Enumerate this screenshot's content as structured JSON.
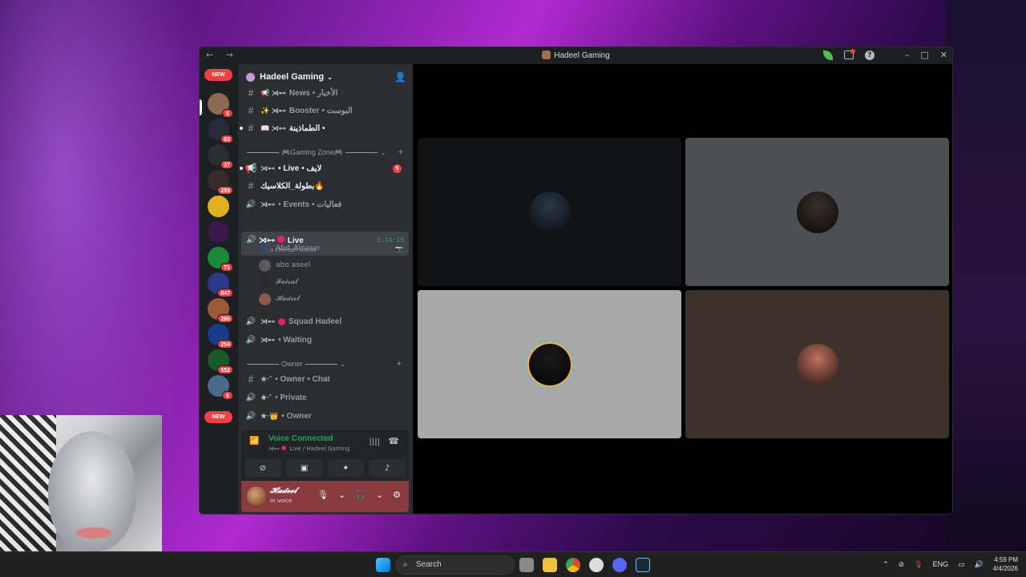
{
  "window": {
    "title": "Hadeel Gaming",
    "nav_arrows": "← →",
    "minimize": "–",
    "maximize": "□",
    "close": "✕"
  },
  "server": {
    "name": "Hadeel Gaming"
  },
  "guilds": [
    {
      "name": "server-1",
      "badge": "5",
      "color": "#8a6a50"
    },
    {
      "name": "server-2",
      "badge": "63",
      "color": "#2a2a3a"
    },
    {
      "name": "server-3",
      "badge": "37",
      "color": "#2a2d31"
    },
    {
      "name": "server-4",
      "badge": "255",
      "color": "#3a2a2a"
    },
    {
      "name": "server-5",
      "badge": "",
      "color": "#e0b020"
    },
    {
      "name": "server-6",
      "badge": "",
      "color": "#3a1a4a"
    },
    {
      "name": "server-7",
      "badge": "71",
      "color": "#1a8a3a"
    },
    {
      "name": "server-8",
      "badge": "847",
      "color": "#2a3a8a"
    },
    {
      "name": "server-9",
      "badge": "260",
      "color": "#9a5a3a"
    },
    {
      "name": "server-10",
      "badge": "254",
      "color": "#1a3a8a"
    },
    {
      "name": "server-11",
      "badge": "552",
      "color": "#1a5a2a"
    },
    {
      "name": "server-12",
      "badge": "6",
      "color": "#4a6a8a"
    }
  ],
  "guild_new_top": "NEW",
  "guild_new_bottom": "NEW",
  "channels": {
    "news": "News • الأخبار",
    "booster": "Booster • البوست",
    "mod": "الطماذينة •",
    "cat_gaming": "Gaming Zone",
    "live_text": "• Live • لايف",
    "live_text_badge": "5",
    "tournament": "بطولة_الكلاسيك",
    "events": "• Events • فعاليات",
    "live_voice": "Live",
    "live_status": "Set a channel status",
    "live_timer": "5:14:15",
    "squad": "Squad Hadeel",
    "waiting": "• Waiting",
    "cat_owner": "Owner",
    "owner_chat": "• Owner • Chat",
    "private": "• Private",
    "owner": "• Owner"
  },
  "voice_users": [
    {
      "name": "Abd_Alnaser",
      "color": "#3a4a5a"
    },
    {
      "name": "abo aseel",
      "color": "#5a5a5a"
    },
    {
      "name": "𝓕𝓪𝓲𝓼𝓪𝓵",
      "color": "#2a2a2a"
    },
    {
      "name": "𝓗𝓪𝓭𝓮𝓮𝓵",
      "color": "#8a5a4a"
    }
  ],
  "voice_panel": {
    "title": "Voice Connected",
    "subtitle": "Live / Hadeel Gaming"
  },
  "user": {
    "name": "𝓗𝓪𝓭𝓮𝓮𝓵",
    "status": "In voice"
  },
  "tiles": [
    {
      "bg": "#111214",
      "avatar": "#2a3a4a"
    },
    {
      "bg": "#4e4f52",
      "avatar": "#3a3028"
    },
    {
      "bg": "#a8a8a8",
      "avatar": "#1a1a1a"
    },
    {
      "bg": "#3e302a",
      "avatar": "#c07060"
    }
  ],
  "taskbar": {
    "search": "Search",
    "lang": "ENG",
    "time": "4:59 PM",
    "date": "4/4/2026"
  }
}
